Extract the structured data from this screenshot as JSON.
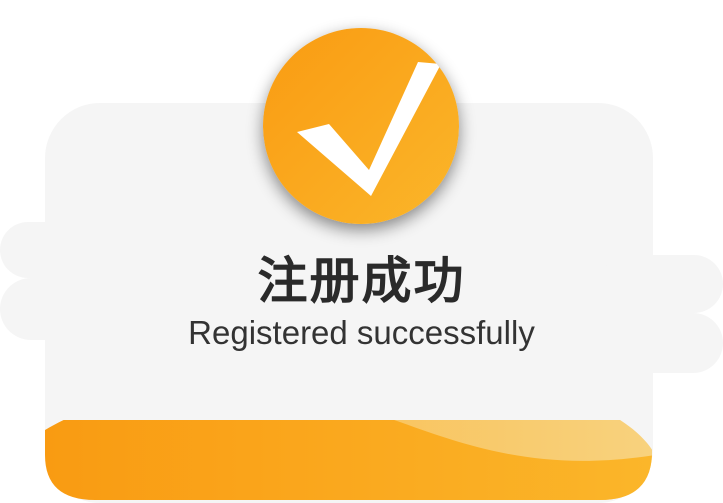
{
  "dialog": {
    "title": "注册成功",
    "subtitle": "Registered successfully",
    "icon": "checkmark-icon",
    "colors": {
      "accent_start": "#f99b12",
      "accent_end": "#fbb62a",
      "wave_light": "#f8cd78",
      "card_background": "#f5f5f5",
      "title_text": "#2a2a2a"
    }
  }
}
